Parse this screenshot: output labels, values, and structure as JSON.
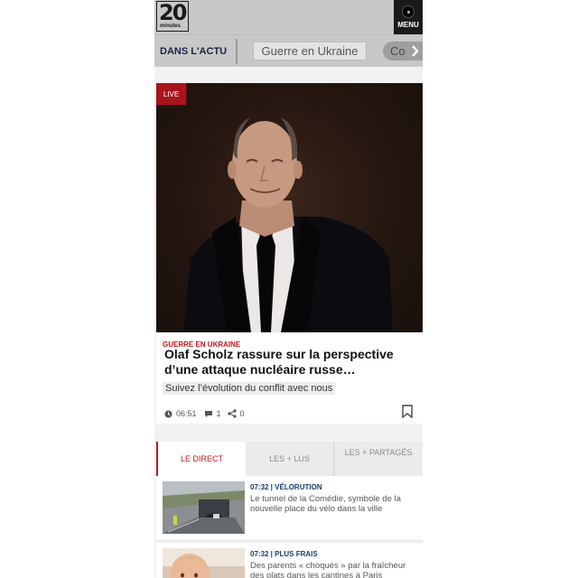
{
  "header": {
    "logo_number": "20",
    "logo_sub": "minutes",
    "menu_label": "MENU"
  },
  "actu": {
    "label": "DANS L'ACTU",
    "chips": [
      "Guerre en Ukraine",
      "Co"
    ]
  },
  "featured": {
    "badge": "LIVE",
    "kicker": "GUERRE EN UKRAINE",
    "headline": "Olaf Scholz rassure sur la perspective d’une attaque nucléaire russe…",
    "follow": "Suivez l’évolution du conflit avec nous",
    "time": "06:51",
    "comments": "1",
    "shares": "0"
  },
  "tabs": [
    "LE DIRECT",
    "LES + LUS",
    "LES + PARTAGÉS"
  ],
  "news": [
    {
      "time_tag": "07:32 | VÉLORUTION",
      "title": "Le tunnel de la Comédie, symbole de la nouvelle place du vélo dans la ville"
    },
    {
      "time_tag": "07:32 | PLUS FRAIS",
      "title": "Des parents « choqués » par la fraîcheur des plats dans les cantines à Paris"
    }
  ],
  "colors": {
    "accent_red": "#c4161c",
    "navy": "#1b3e74",
    "header_grey": "#c8c8c8"
  },
  "icons": [
    "menu-icon",
    "chevron-right-icon",
    "clock-icon",
    "comment-icon",
    "share-icon",
    "bookmark-icon"
  ]
}
